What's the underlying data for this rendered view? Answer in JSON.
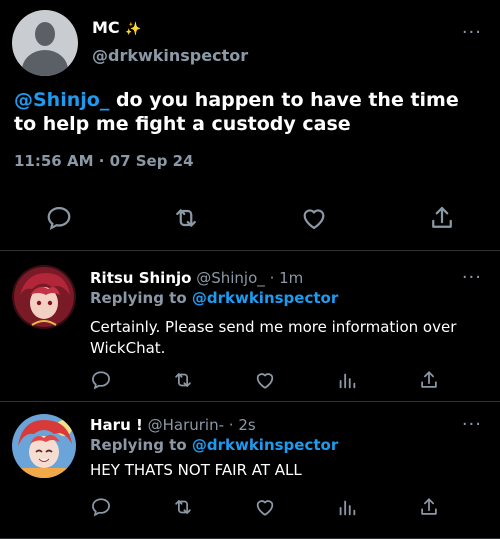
{
  "main_tweet": {
    "author_name": "MC",
    "author_emoji": "✨",
    "author_handle": "@drkwkinspector",
    "more": "···",
    "mention": "@Shinjo_",
    "text": " do you happen to have the time to help me fight a custody case",
    "timestamp": "11:56 AM · 07 Sep 24",
    "actions": [
      "reply-icon",
      "retweet-icon",
      "like-icon",
      "share-icon"
    ]
  },
  "replies": [
    {
      "name": "Ritsu Shinjo",
      "handle": "@Shinjo_",
      "time": " · 1m",
      "replying_label": "Replying to ",
      "replying_to": "@drkwkinspector",
      "text": "Certainly. Please send me more information over WickChat.",
      "more": "···",
      "avatar_color": "#b3263a"
    },
    {
      "name": "Haru !",
      "handle": "@Harurin-",
      "time": " · 2s",
      "replying_label": "Replying to ",
      "replying_to": "@drkwkinspector",
      "text": "HEY THATS NOT FAIR AT ALL",
      "more": "···",
      "avatar_color": "#d83a3a"
    }
  ],
  "colors": {
    "accent": "#1d9bf0",
    "muted": "#8b98a5",
    "divider": "#2f3336",
    "background": "#000000"
  }
}
